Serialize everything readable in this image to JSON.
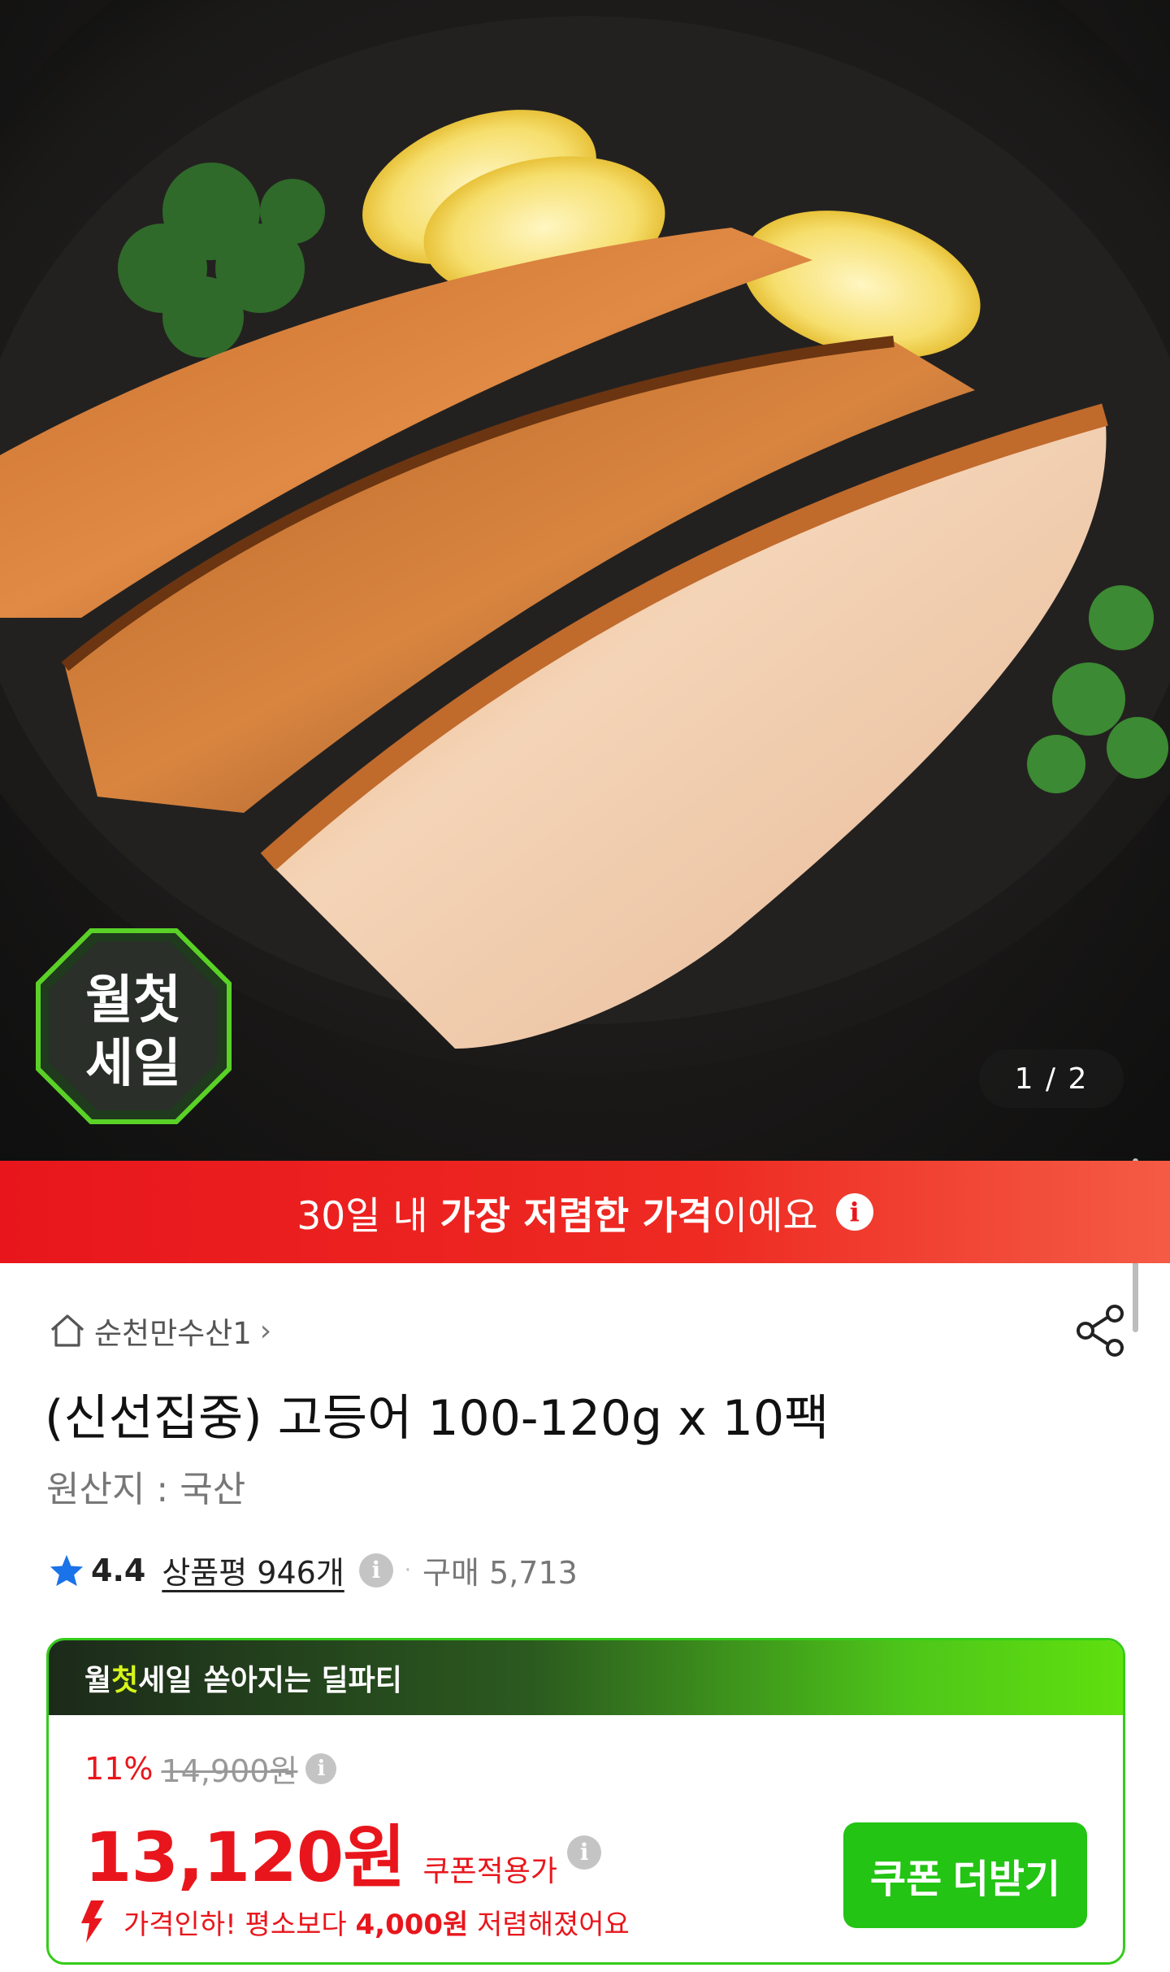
{
  "hero": {
    "image_description_icon": "fish-product-photo",
    "counter": "1 / 2",
    "badge_line1": "월첫",
    "badge_line2": "세일"
  },
  "banner": {
    "text_prefix": "30일 내 ",
    "text_bold": "가장 저렴한 가격",
    "text_suffix": "이에요",
    "info_icon": "i"
  },
  "product": {
    "store_name": "순천만수산1",
    "store_chevron": "›",
    "title": "(신선집중) 고등어 100-120g x 10팩",
    "origin": "원산지 : 국산",
    "rating": "4.4",
    "reviews_label": "상품평 946개",
    "dot": "·",
    "purchases": "구매 5,713"
  },
  "deal": {
    "head_a": "월",
    "head_b": "첫",
    "head_c": "세일",
    "head_tail": "쏟아지는 딜파티",
    "discount_pct": "11%",
    "original_price": "14,900원",
    "price": "13,120원",
    "coupon_price_label": "쿠폰적용가",
    "price_down_prefix": "가격인하! 평소보다 ",
    "price_down_amount": "4,000원",
    "price_down_suffix": " 저렴해졌어요",
    "coupon_button": "쿠폰 더받기"
  },
  "colors": {
    "accent_red": "#e8161c",
    "accent_green": "#23c414"
  }
}
